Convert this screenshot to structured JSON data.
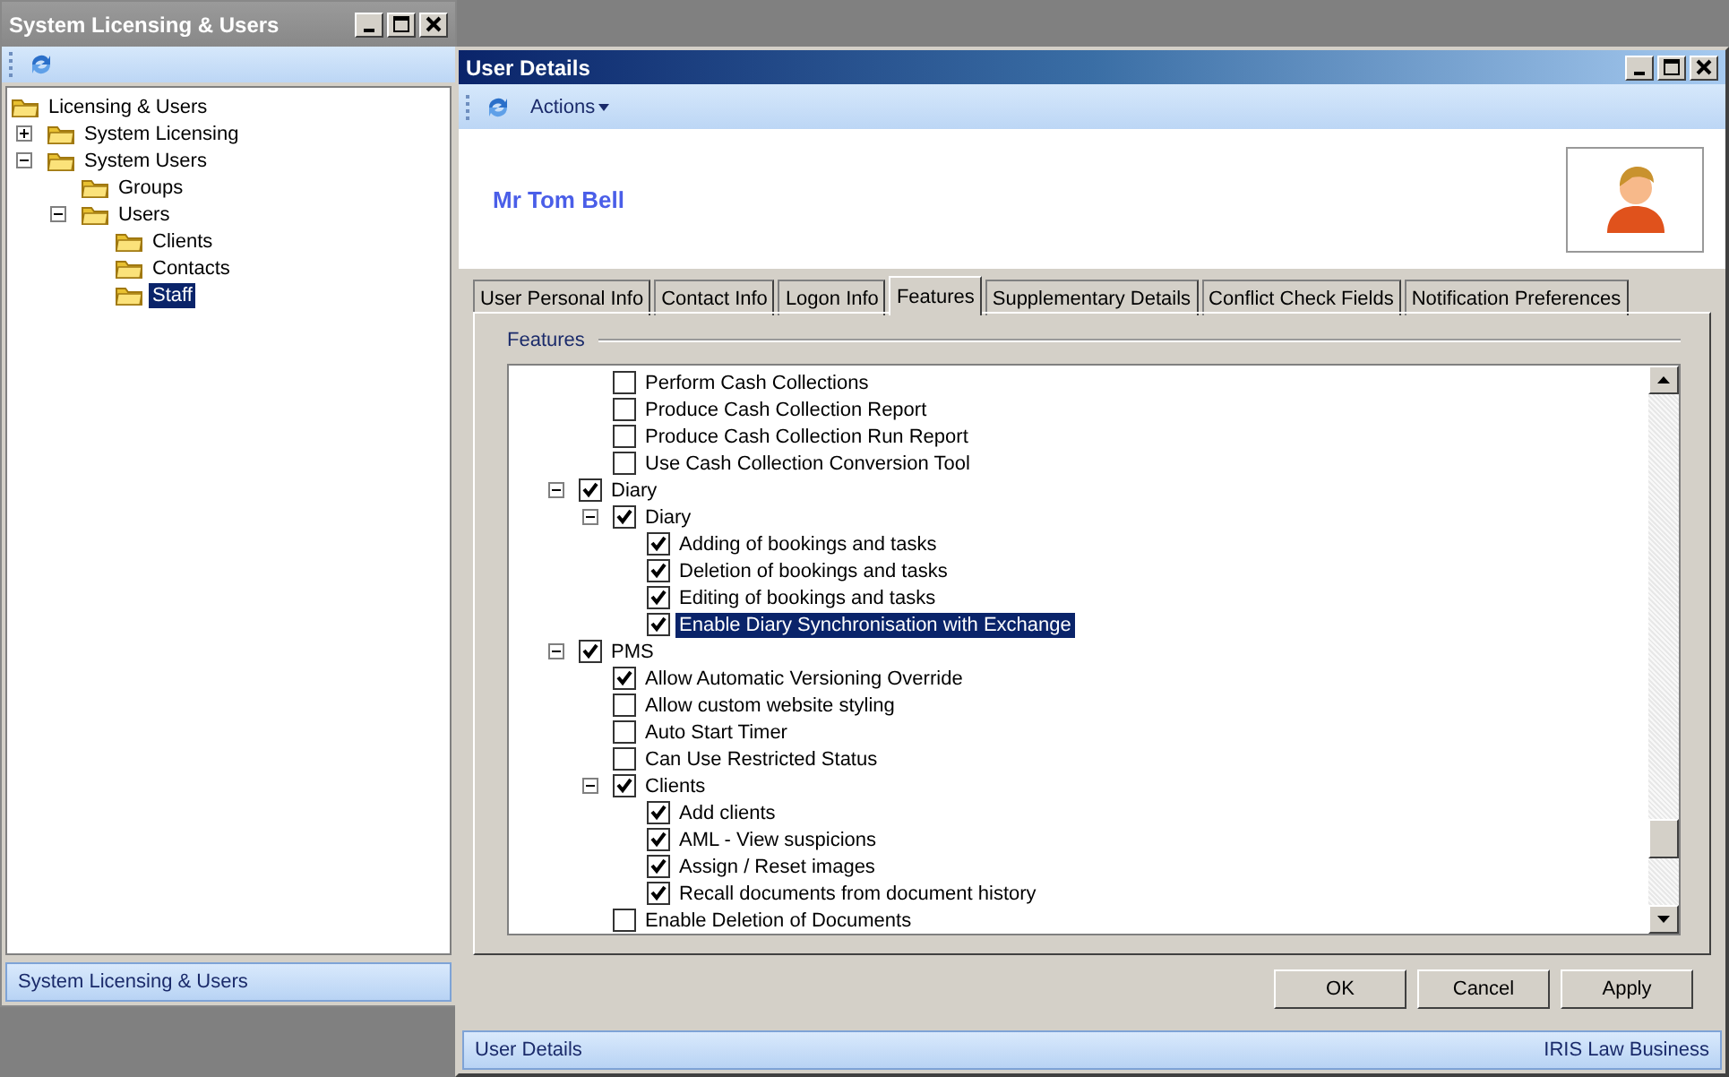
{
  "main_window": {
    "title": "System Licensing & Users",
    "tree": [
      {
        "label": "Licensing & Users",
        "selected": false,
        "children": [
          {
            "label": "System Licensing",
            "selected": false,
            "expanded": false
          },
          {
            "label": "System Users",
            "selected": false,
            "expanded": true,
            "children": [
              {
                "label": "Groups",
                "selected": false
              },
              {
                "label": "Users",
                "selected": false,
                "expanded": true,
                "children": [
                  {
                    "label": "Clients",
                    "selected": false
                  },
                  {
                    "label": "Contacts",
                    "selected": false
                  },
                  {
                    "label": "Staff",
                    "selected": true
                  }
                ]
              }
            ]
          }
        ]
      }
    ],
    "status_bar": "System Licensing & Users"
  },
  "details_window": {
    "title": "User Details",
    "toolbar": {
      "actions": "Actions"
    },
    "user_name": "Mr Tom Bell",
    "tabs": [
      {
        "label": "User Personal Info",
        "selected": false
      },
      {
        "label": "Contact Info",
        "selected": false
      },
      {
        "label": "Logon Info",
        "selected": false
      },
      {
        "label": "Features",
        "selected": true
      },
      {
        "label": "Supplementary Details",
        "selected": false
      },
      {
        "label": "Conflict Check Fields",
        "selected": false
      },
      {
        "label": "Notification Preferences",
        "selected": false
      }
    ],
    "features": {
      "group_title": "Features",
      "items": [
        {
          "children": [
            {
              "label": "Perform Cash Collections",
              "checked": false,
              "selected": false
            },
            {
              "label": "Produce Cash Collection Report",
              "checked": false,
              "selected": false
            },
            {
              "label": "Produce Cash Collection Run Report",
              "checked": false,
              "selected": false
            },
            {
              "label": "Use Cash Collection Conversion Tool",
              "checked": false,
              "selected": false
            }
          ]
        },
        {
          "label": "Diary",
          "checked": true,
          "selected": false,
          "expanded": true,
          "children": [
            {
              "label": "Diary",
              "checked": true,
              "selected": false,
              "expanded": true,
              "children": [
                {
                  "label": "Adding of bookings and tasks",
                  "checked": true,
                  "selected": false
                },
                {
                  "label": "Deletion of bookings and tasks",
                  "checked": true,
                  "selected": false
                },
                {
                  "label": "Editing of bookings and tasks",
                  "checked": true,
                  "selected": false
                },
                {
                  "label": "Enable Diary Synchronisation with Exchange",
                  "checked": true,
                  "selected": true
                }
              ]
            }
          ]
        },
        {
          "label": "PMS",
          "checked": true,
          "selected": false,
          "expanded": true,
          "children": [
            {
              "label": "Allow Automatic Versioning Override",
              "checked": true,
              "selected": false
            },
            {
              "label": "Allow custom website styling",
              "checked": false,
              "selected": false
            },
            {
              "label": "Auto Start Timer",
              "checked": false,
              "selected": false
            },
            {
              "label": "Can Use Restricted Status",
              "checked": false,
              "selected": false
            },
            {
              "label": "Clients",
              "checked": true,
              "selected": false,
              "expanded": true,
              "children": [
                {
                  "label": "Add clients",
                  "checked": true,
                  "selected": false
                },
                {
                  "label": "AML - View suspicions",
                  "checked": true,
                  "selected": false
                },
                {
                  "label": "Assign / Reset images",
                  "checked": true,
                  "selected": false
                },
                {
                  "label": "Recall documents from document history",
                  "checked": true,
                  "selected": false
                }
              ]
            },
            {
              "label": "Enable Deletion of Documents",
              "checked": false,
              "selected": false
            }
          ]
        }
      ]
    },
    "buttons": [
      "OK",
      "Cancel",
      "Apply"
    ],
    "status_bar": {
      "left": "User Details",
      "right": "IRIS Law Business"
    }
  }
}
